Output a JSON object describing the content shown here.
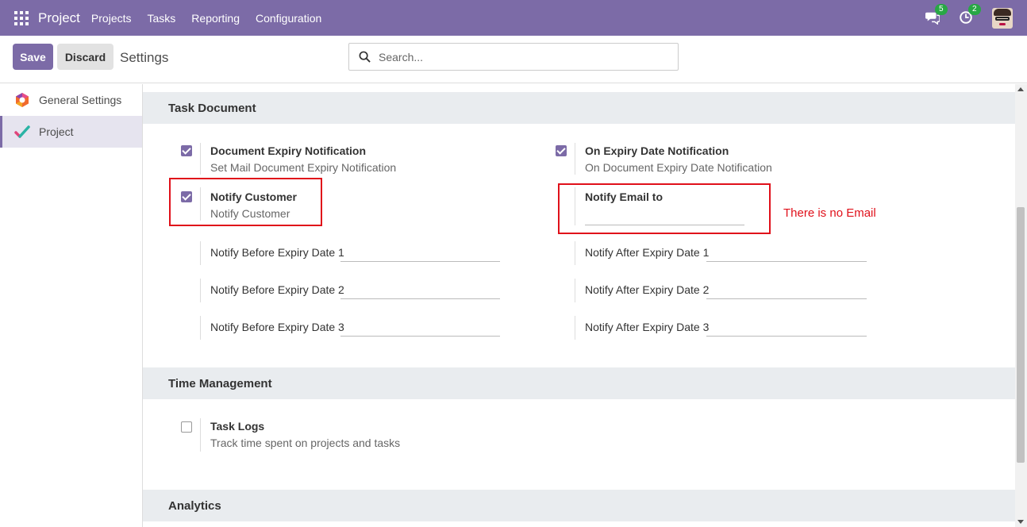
{
  "navbar": {
    "brand": "Project",
    "menu": [
      "Projects",
      "Tasks",
      "Reporting",
      "Configuration"
    ],
    "messages_count": "5",
    "activities_count": "2",
    "accent_color": "#7c6ba7"
  },
  "control": {
    "save_label": "Save",
    "discard_label": "Discard",
    "breadcrumb": "Settings",
    "search_placeholder": "Search..."
  },
  "sidebar": {
    "items": [
      {
        "label": "General Settings",
        "icon": "odoo-hexagon-icon",
        "active": false
      },
      {
        "label": "Project",
        "icon": "project-check-icon",
        "active": true
      }
    ]
  },
  "sections": {
    "task_document": {
      "title": "Task Document",
      "doc_expiry": {
        "title": "Document Expiry Notification",
        "desc": "Set Mail Document Expiry Notification",
        "checked": true
      },
      "on_expiry": {
        "title": "On Expiry Date Notification",
        "desc": "On Document Expiry Date Notification",
        "checked": true
      },
      "notify_customer": {
        "title": "Notify Customer",
        "desc": "Notify Customer",
        "checked": true
      },
      "notify_email": {
        "title": "Notify Email to",
        "value": ""
      },
      "before": [
        "Notify Before Expiry Date 1",
        "Notify Before Expiry Date 2",
        "Notify Before Expiry Date 3"
      ],
      "after": [
        "Notify After Expiry Date 1",
        "Notify After Expiry Date 2",
        "Notify After Expiry Date 3"
      ]
    },
    "time_management": {
      "title": "Time Management",
      "task_logs": {
        "title": "Task Logs",
        "desc": "Track time spent on projects and tasks",
        "checked": false
      }
    },
    "analytics": {
      "title": "Analytics"
    }
  },
  "annotation": {
    "note": "There is no Email",
    "color": "#e0101a"
  }
}
